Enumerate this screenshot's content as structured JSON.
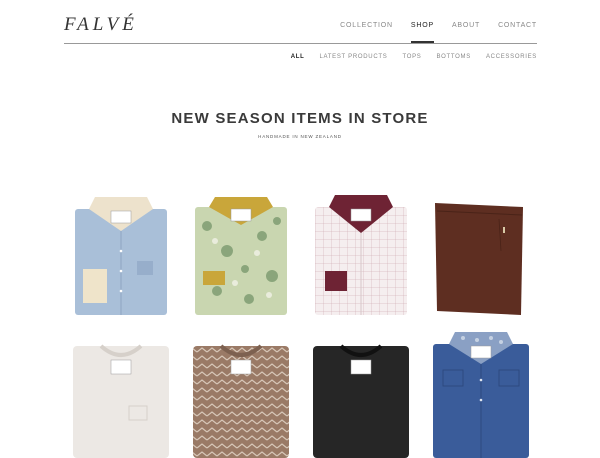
{
  "brand": {
    "name": "FALVÉ"
  },
  "nav": {
    "items": [
      {
        "label": "COLLECTION",
        "active": false
      },
      {
        "label": "SHOP",
        "active": true
      },
      {
        "label": "ABOUT",
        "active": false
      },
      {
        "label": "CONTACT",
        "active": false
      }
    ]
  },
  "filters": {
    "items": [
      {
        "label": "ALL",
        "active": true
      },
      {
        "label": "LATEST PRODUCTS",
        "active": false
      },
      {
        "label": "TOPS",
        "active": false
      },
      {
        "label": "BOTTOMS",
        "active": false
      },
      {
        "label": "ACCESSORIES",
        "active": false
      }
    ]
  },
  "hero": {
    "title": "NEW SEASON ITEMS IN STORE",
    "subtitle": "HANDMADE IN NEW ZEALAND"
  },
  "products": [
    {
      "kind": "shirt",
      "icon": "blue-shirt-icon",
      "body": "#a9bfd8",
      "collar": "#ede2cc",
      "accent": "#efe4ca"
    },
    {
      "kind": "shirt",
      "icon": "floral-shirt-icon",
      "body": "#c9d6b0",
      "collar": "#c9a63a",
      "accent": "#c9a63a"
    },
    {
      "kind": "shirt",
      "icon": "check-shirt-icon",
      "body": "#f3ebec",
      "collar": "#6e2334",
      "accent": "#6e2334"
    },
    {
      "kind": "trousers",
      "icon": "brown-trousers-icon",
      "body": "#5e2e21",
      "collar": "#5e2e21",
      "accent": "#5e2e21"
    },
    {
      "kind": "tee",
      "icon": "white-tee-icon",
      "body": "#ece8e4",
      "collar": "#ece8e4",
      "accent": "#ece8e4"
    },
    {
      "kind": "tee",
      "icon": "chevron-tee-icon",
      "body": "#9a7a66",
      "collar": "#9a7a66",
      "accent": "#9a7a66"
    },
    {
      "kind": "tee",
      "icon": "black-tee-icon",
      "body": "#262626",
      "collar": "#262626",
      "accent": "#262626"
    },
    {
      "kind": "shirt",
      "icon": "denim-shirt-icon",
      "body": "#3a5c9a",
      "collar": "#8aa0c4",
      "accent": "#3a5c9a"
    }
  ]
}
